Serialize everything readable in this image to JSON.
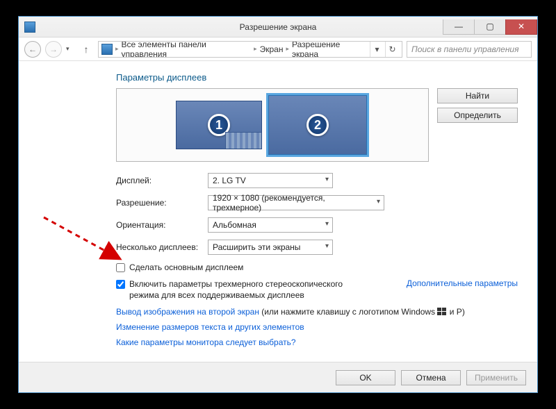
{
  "window": {
    "title": "Разрешение экрана"
  },
  "nav": {
    "breadcrumb": [
      "Все элементы панели управления",
      "Экран",
      "Разрешение экрана"
    ],
    "search_placeholder": "Поиск в панели управления"
  },
  "heading": "Параметры дисплеев",
  "monitors": {
    "m1": "1",
    "m2": "2"
  },
  "buttons": {
    "find": "Найти",
    "identify": "Определить",
    "ok": "OK",
    "cancel": "Отмена",
    "apply": "Применить"
  },
  "form": {
    "display_label": "Дисплей:",
    "display_value": "2. LG TV",
    "resolution_label": "Разрешение:",
    "resolution_value": "1920 × 1080 (рекомендуется, трехмерное)",
    "orientation_label": "Ориентация:",
    "orientation_value": "Альбомная",
    "multi_label": "Несколько дисплеев:",
    "multi_value": "Расширить эти экраны"
  },
  "checkboxes": {
    "make_main": "Сделать основным дисплеем",
    "stereo3d": "Включить параметры трехмерного стереоскопического режима для всех поддерживаемых дисплеев"
  },
  "links": {
    "advanced": "Дополнительные параметры",
    "project_prefix": "Вывод изображения на второй экран",
    "project_suffix": " (или нажмите клавишу с логотипом Windows ",
    "project_tail": " и P)",
    "text_size": "Изменение размеров текста и других элементов",
    "which_settings": "Какие параметры монитора следует выбрать?"
  }
}
